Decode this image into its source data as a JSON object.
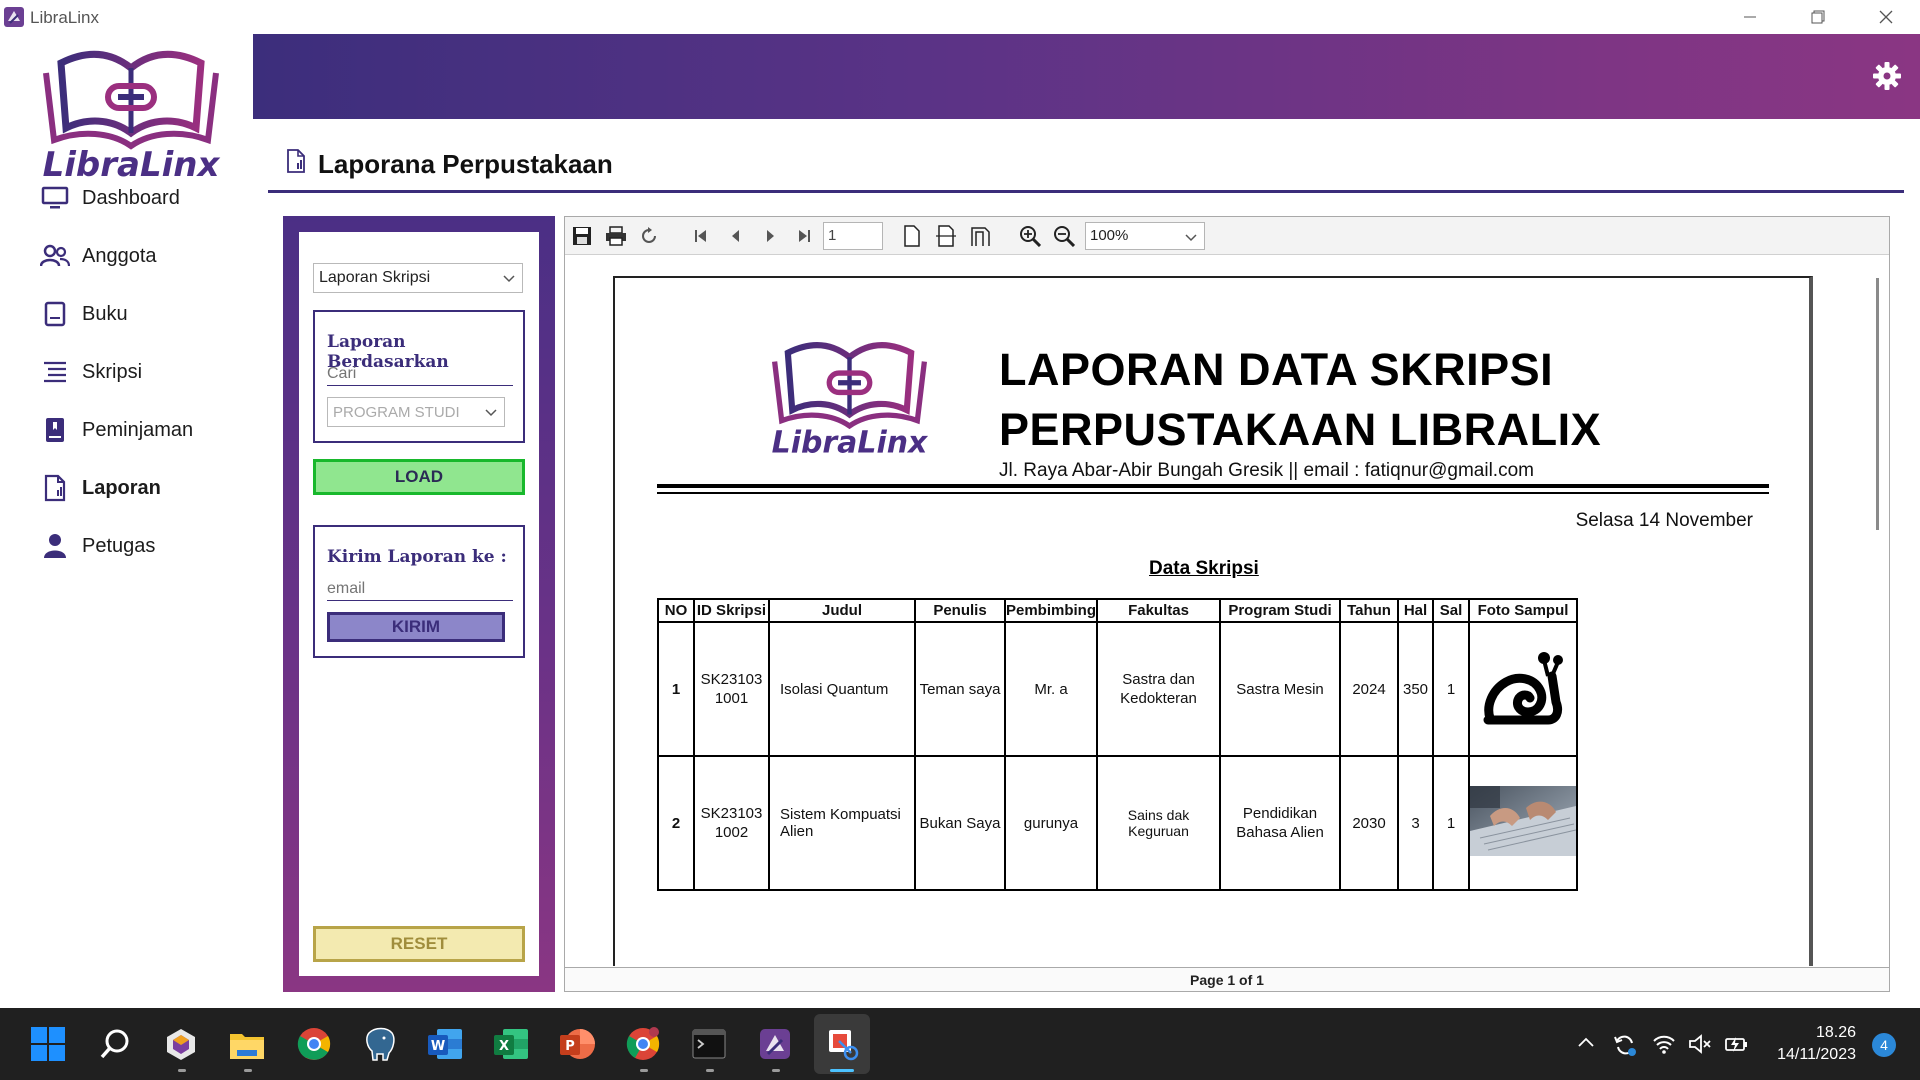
{
  "window": {
    "title": "LibraLinx"
  },
  "brand": {
    "logo_text": "LibraLinx",
    "accent": "#3b2d7a",
    "accent2": "#8a3683"
  },
  "sidebar": {
    "items": [
      {
        "label": "Dashboard",
        "icon": "monitor-icon"
      },
      {
        "label": "Anggota",
        "icon": "users-icon"
      },
      {
        "label": "Buku",
        "icon": "book-icon"
      },
      {
        "label": "Skripsi",
        "icon": "list-icon"
      },
      {
        "label": "Peminjaman",
        "icon": "book-mark-icon"
      },
      {
        "label": "Laporan",
        "icon": "document-icon",
        "active": true
      },
      {
        "label": "Petugas",
        "icon": "person-icon"
      }
    ]
  },
  "page": {
    "title": "Laporana Perpustakaan"
  },
  "controls": {
    "report_type": "Laporan Skripsi",
    "filter_group_title": "Laporan Berdasarkan",
    "search_placeholder": "Cari",
    "program_placeholder": "PROGRAM STUDI",
    "load_label": "LOAD",
    "send_group_title": "Kirim Laporan ke :",
    "email_placeholder": "email",
    "send_label": "KIRIM",
    "reset_label": "RESET"
  },
  "viewer": {
    "page_number": "1",
    "zoom": "100%",
    "status": "Page 1 of 1"
  },
  "report": {
    "title_line1": "LAPORAN DATA SKRIPSI",
    "title_line2": "PERPUSTAKAAN LIBRALIX",
    "address": "Jl. Raya Abar-Abir Bungah Gresik   || email : fatiqnur@gmail.com",
    "date": "Selasa 14 November",
    "subtitle": "Data Skripsi",
    "columns": [
      "NO",
      "ID Skripsi",
      "Judul",
      "Penulis",
      "Pembimbing",
      "Fakultas",
      "Program Studi",
      "Tahun",
      "Hal",
      "Sal",
      "Foto Sampul"
    ],
    "rows": [
      {
        "no": "1",
        "id": "SK231031001",
        "judul": "Isolasi Quantum",
        "penulis": "Teman saya",
        "pembimbing": "Mr. a",
        "fakultas": "Sastra dan Kedokteran",
        "prodi": "Sastra Mesin",
        "tahun": "2024",
        "hal": "350",
        "sal": "1",
        "foto": "snail-icon"
      },
      {
        "no": "2",
        "id": "SK231031002",
        "judul": "Sistem Kompuatsi Alien",
        "penulis": "Bukan Saya",
        "pembimbing": "gurunya",
        "fakultas": "Sains dak Keguruan",
        "prodi": "Pendidikan Bahasa Alien",
        "tahun": "2030",
        "hal": "3",
        "sal": "1",
        "foto": "laptop-photo"
      }
    ]
  },
  "taskbar": {
    "time": "18.26",
    "date": "14/11/2023",
    "notifications": "4"
  }
}
